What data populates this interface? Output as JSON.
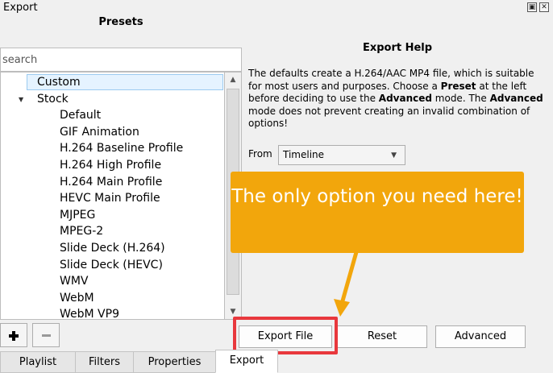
{
  "window": {
    "title": "Export"
  },
  "presets": {
    "heading": "Presets",
    "search_placeholder": "search",
    "items": [
      {
        "label": "Custom",
        "level": 1,
        "selected": true
      },
      {
        "label": "Stock",
        "level": 0,
        "expanded": true
      },
      {
        "label": "Default",
        "level": 2
      },
      {
        "label": "GIF Animation",
        "level": 2
      },
      {
        "label": "H.264 Baseline Profile",
        "level": 2
      },
      {
        "label": "H.264 High Profile",
        "level": 2
      },
      {
        "label": "H.264 Main Profile",
        "level": 2
      },
      {
        "label": "HEVC Main Profile",
        "level": 2
      },
      {
        "label": "MJPEG",
        "level": 2
      },
      {
        "label": "MPEG-2",
        "level": 2
      },
      {
        "label": "Slide Deck (H.264)",
        "level": 2
      },
      {
        "label": "Slide Deck (HEVC)",
        "level": 2
      },
      {
        "label": "WMV",
        "level": 2
      },
      {
        "label": "WebM",
        "level": 2
      },
      {
        "label": "WebM VP9",
        "level": 2
      }
    ]
  },
  "help": {
    "title": "Export Help",
    "segments": [
      {
        "text": "The defaults create a H.264/AAC MP4 file, which is suitable for most users and purposes. Choose a ",
        "bold": false
      },
      {
        "text": "Preset",
        "bold": true
      },
      {
        "text": " at the left before deciding to use the ",
        "bold": false
      },
      {
        "text": "Advanced",
        "bold": true
      },
      {
        "text": " mode. The ",
        "bold": false
      },
      {
        "text": "Advanced",
        "bold": true
      },
      {
        "text": " mode does not prevent creating an invalid combination of options!",
        "bold": false
      }
    ]
  },
  "from": {
    "label": "From",
    "value": "Timeline"
  },
  "callout": {
    "text": "The only option you need here!"
  },
  "buttons": {
    "export_file": "Export File",
    "reset": "Reset",
    "advanced": "Advanced"
  },
  "tabs": [
    "Playlist",
    "Filters",
    "Properties",
    "Export"
  ],
  "colors": {
    "callout": "#f2a60c",
    "highlight": "#e8383d"
  }
}
